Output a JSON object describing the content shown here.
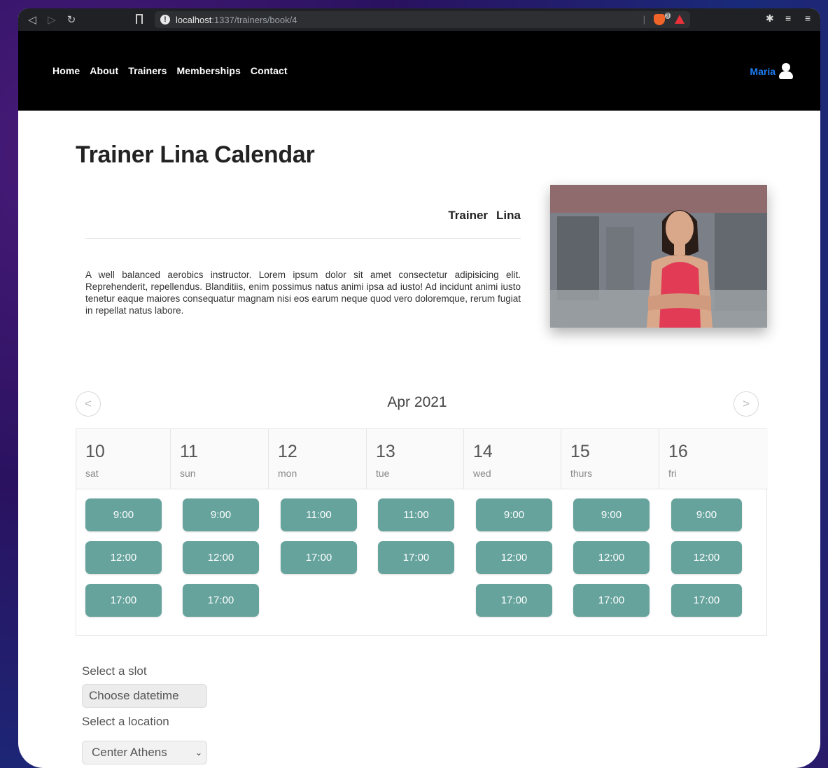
{
  "browser": {
    "url_host": "localhost",
    "url_path": ":1337/trainers/book/4",
    "brave_count": "3"
  },
  "nav": {
    "links": [
      "Home",
      "About",
      "Trainers",
      "Memberships",
      "Contact"
    ],
    "user_name": "Maria"
  },
  "page": {
    "title": "Trainer Lina Calendar",
    "trainer_first": "Trainer",
    "trainer_last": "Lina",
    "description": "A well balanced aerobics instructor. Lorem ipsum dolor sit amet consectetur adipisicing elit. Reprehenderit, repellendus. Blanditiis, enim possimus natus animi ipsa ad iusto! Ad incidunt animi iusto tenetur eaque maiores consequatur magnam nisi eos earum neque quod vero doloremque, rerum fugiat in repellat natus labore."
  },
  "calendar": {
    "month": "Apr 2021",
    "prev": "<",
    "next": ">",
    "days": [
      {
        "num": "10",
        "dow": "sat",
        "slots": [
          "9:00",
          "12:00",
          "17:00"
        ]
      },
      {
        "num": "11",
        "dow": "sun",
        "slots": [
          "9:00",
          "12:00",
          "17:00"
        ]
      },
      {
        "num": "12",
        "dow": "mon",
        "slots": [
          "11:00",
          "17:00"
        ]
      },
      {
        "num": "13",
        "dow": "tue",
        "slots": [
          "11:00",
          "17:00"
        ]
      },
      {
        "num": "14",
        "dow": "wed",
        "slots": [
          "9:00",
          "12:00",
          "17:00"
        ]
      },
      {
        "num": "15",
        "dow": "thurs",
        "slots": [
          "9:00",
          "12:00",
          "17:00"
        ]
      },
      {
        "num": "16",
        "dow": "fri",
        "slots": [
          "9:00",
          "12:00",
          "17:00"
        ]
      }
    ]
  },
  "form": {
    "slot_label": "Select a slot",
    "slot_value": "Choose datetime",
    "location_label": "Select a location",
    "location_value": "Center Athens"
  },
  "colors": {
    "slot_bg": "#66a39c",
    "user_name": "#1d7cf2"
  }
}
